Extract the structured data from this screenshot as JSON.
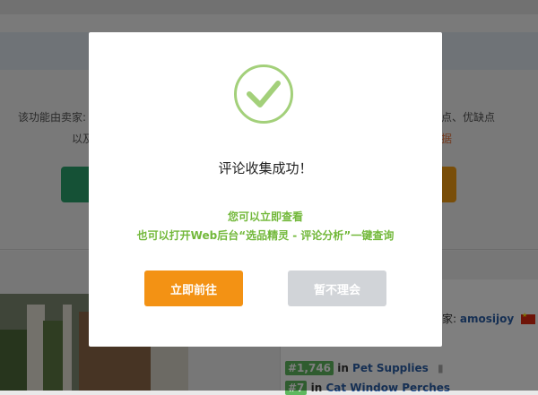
{
  "background": {
    "left_text_line1": "该功能由卖家:",
    "left_text_line2": "以及",
    "right_text_line1": "点、优缺点",
    "right_text_line2": "据",
    "seller_label": "家:",
    "seller_name": "amosijoy",
    "rank1_badge": "#1,746",
    "rank1_in": "in",
    "rank1_category": "Pet Supplies",
    "rank2_badge": "#7",
    "rank2_in": "in",
    "rank2_category": "Cat Window Perches",
    "colors": {
      "green_button": "#2aa36c",
      "orange_button": "#f39c12"
    }
  },
  "modal": {
    "icon": "checkmark-circle-icon",
    "title": "评论收集成功！",
    "description_line1": "您可以立即查看",
    "description_line2": "也可以打开Web后台“选品精灵 - 评论分析”一键查询",
    "primary_button": "立即前往",
    "secondary_button": "暂不理会",
    "colors": {
      "success_green": "#a3d07a",
      "description_green": "#72b83a",
      "primary": "#f39214",
      "secondary": "#d1d4d8"
    }
  }
}
